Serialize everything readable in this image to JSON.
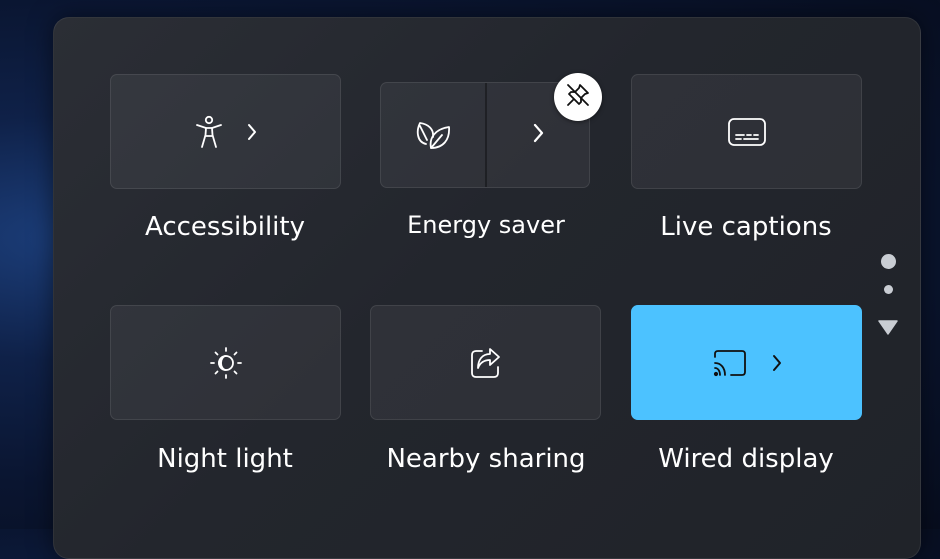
{
  "quick_settings": {
    "tiles": [
      {
        "label": "Accessibility",
        "icon": "accessibility-icon"
      },
      {
        "label": "Energy saver",
        "icon": "leaf-icon"
      },
      {
        "label": "Live captions",
        "icon": "captions-icon"
      },
      {
        "label": "Night light",
        "icon": "night-light-icon"
      },
      {
        "label": "Nearby sharing",
        "icon": "share-icon"
      },
      {
        "label": "Wired display",
        "icon": "cast-icon",
        "active": true
      }
    ],
    "unpin_icon": "unpin-icon",
    "accent_color": "#4cc2ff",
    "panel_color": "#25282f"
  },
  "pagination": {
    "pages": 2,
    "current": 1
  }
}
